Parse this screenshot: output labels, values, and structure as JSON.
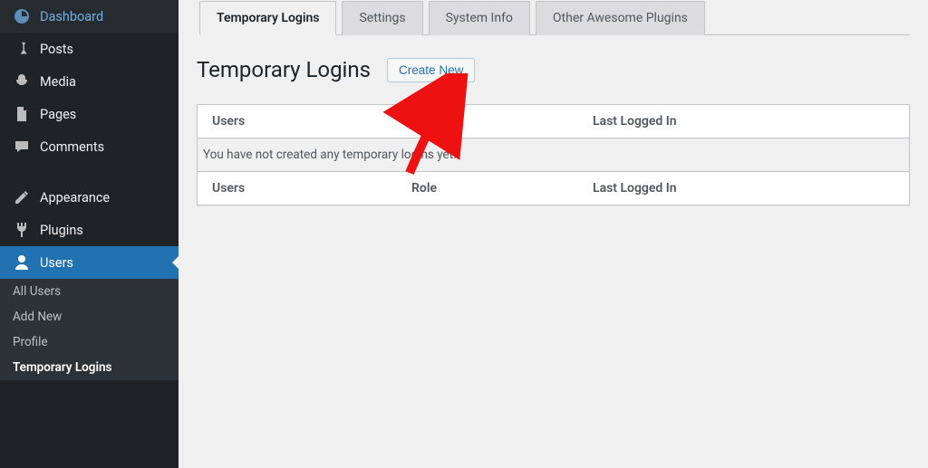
{
  "sidebar": {
    "items": [
      {
        "label": "Dashboard"
      },
      {
        "label": "Posts"
      },
      {
        "label": "Media"
      },
      {
        "label": "Pages"
      },
      {
        "label": "Comments"
      },
      {
        "label": "Appearance"
      },
      {
        "label": "Plugins"
      },
      {
        "label": "Users"
      }
    ],
    "sub_items": [
      {
        "label": "All Users"
      },
      {
        "label": "Add New"
      },
      {
        "label": "Profile"
      },
      {
        "label": "Temporary Logins"
      }
    ]
  },
  "tabs": [
    {
      "label": "Temporary Logins"
    },
    {
      "label": "Settings"
    },
    {
      "label": "System Info"
    },
    {
      "label": "Other Awesome Plugins"
    }
  ],
  "page": {
    "title": "Temporary Logins",
    "create_button": "Create New"
  },
  "table": {
    "headers": {
      "users": "Users",
      "role": "Role",
      "last_logged_in": "Last Logged In"
    },
    "empty_message": "You have not created any temporary logins yet."
  }
}
